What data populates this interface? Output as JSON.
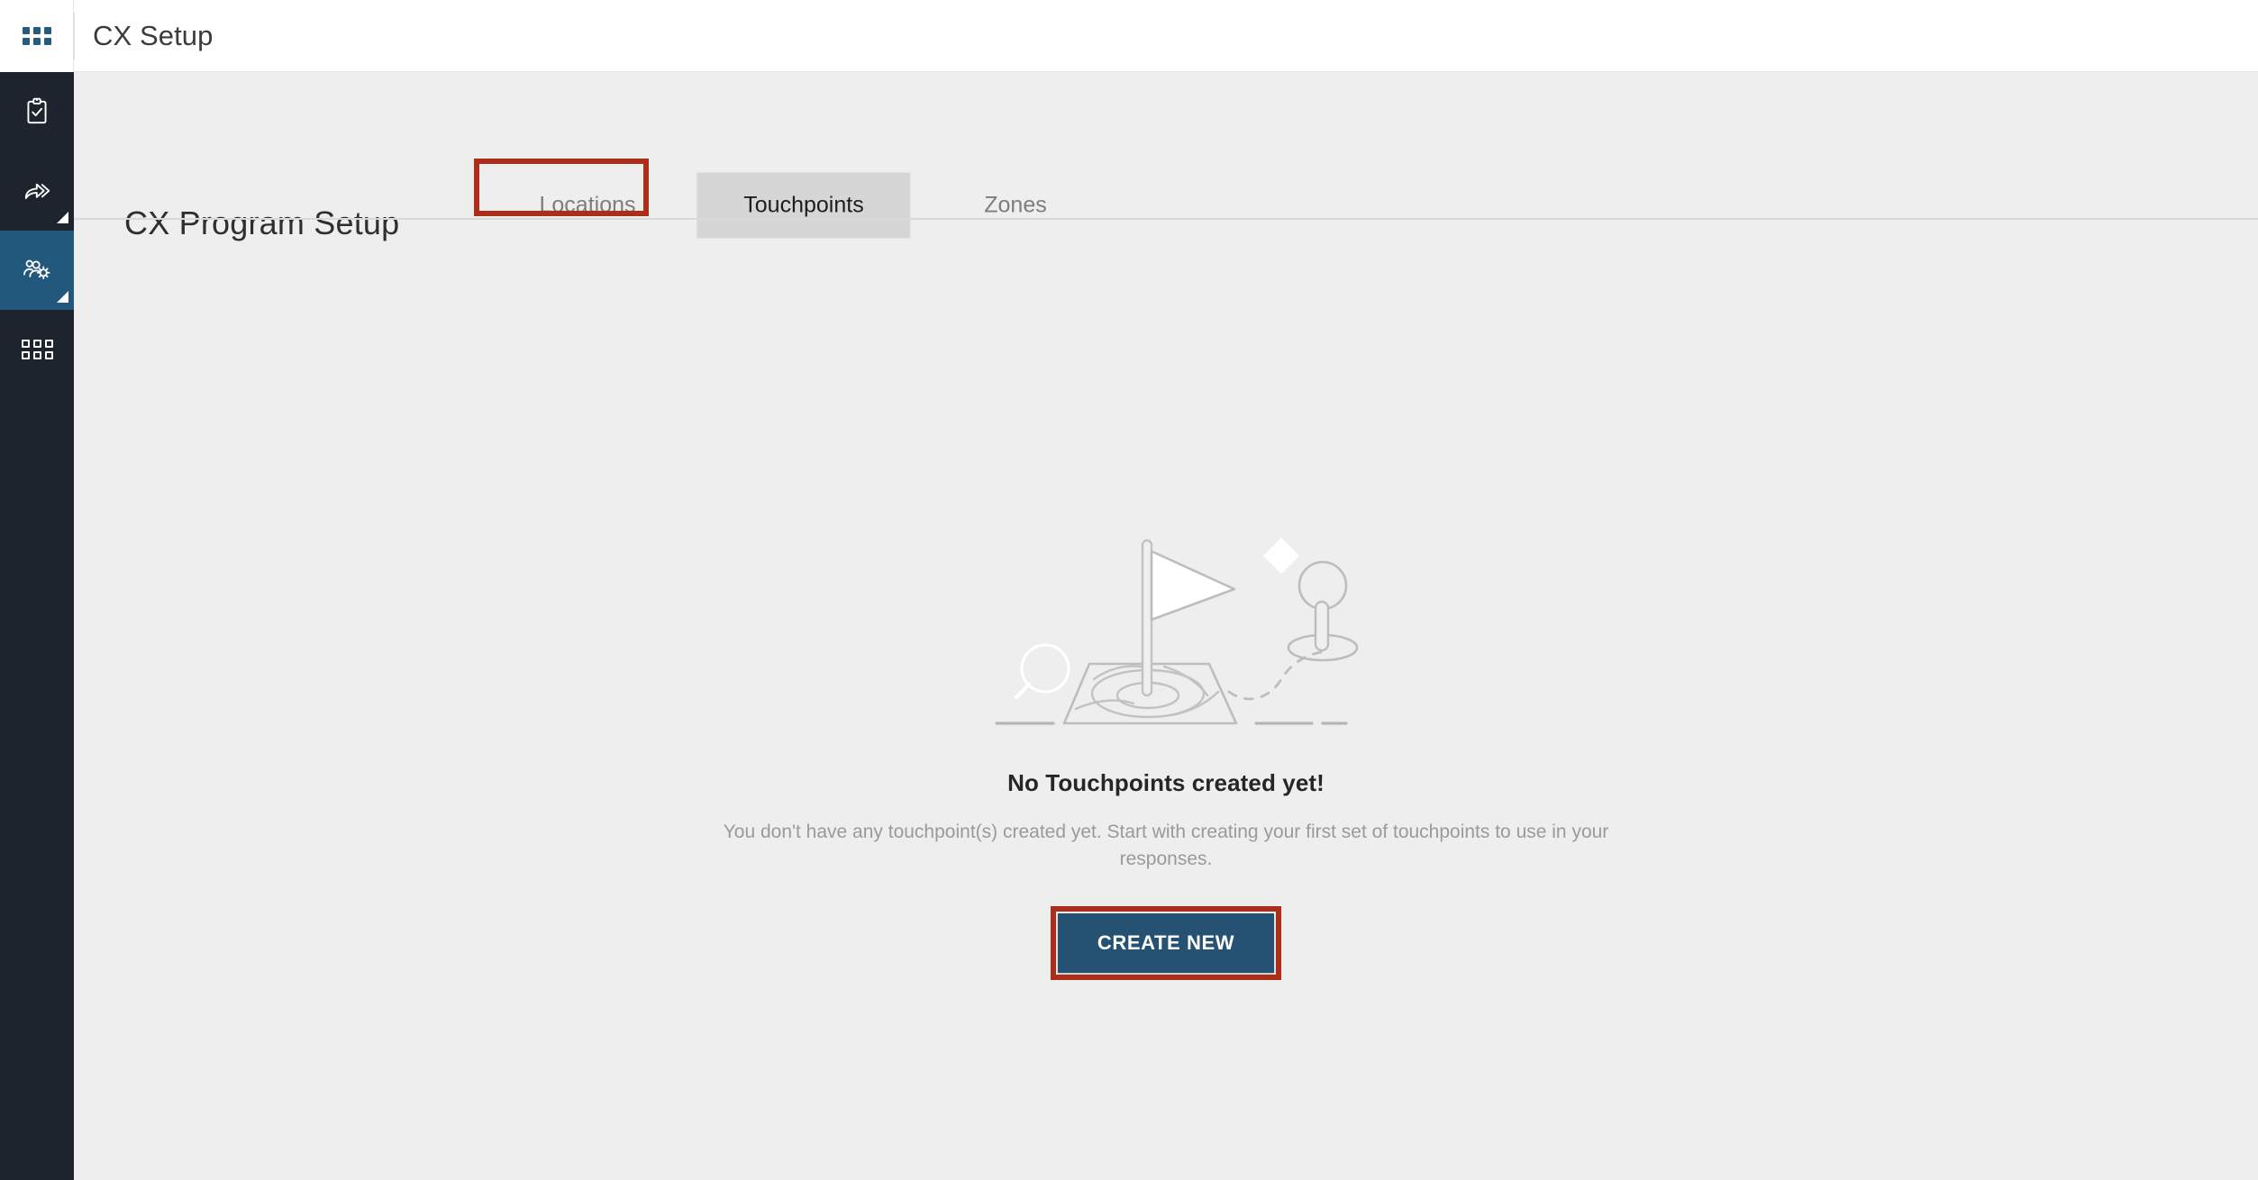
{
  "app": {
    "title": "CX Setup",
    "launcher_icon": "grid-apps-icon"
  },
  "sidebar": {
    "items": [
      {
        "icon": "clipboard-check-icon",
        "name": "surveys",
        "active": false,
        "has_submenu": false
      },
      {
        "icon": "share-forward-icon",
        "name": "distribute",
        "active": false,
        "has_submenu": true
      },
      {
        "icon": "users-gear-icon",
        "name": "cx-setup",
        "active": true,
        "has_submenu": true
      },
      {
        "icon": "grid-squares-icon",
        "name": "modules",
        "active": false,
        "has_submenu": false
      }
    ]
  },
  "page": {
    "title": "CX Program Setup"
  },
  "tabs": [
    {
      "label": "Locations",
      "active": false
    },
    {
      "label": "Touchpoints",
      "active": true
    },
    {
      "label": "Zones",
      "active": false
    }
  ],
  "empty_state": {
    "illustration": "flag-on-map-with-pin-illustration",
    "title": "No Touchpoints created yet!",
    "description": "You don't have any touchpoint(s) created yet. Start with creating your first set of touchpoints to use in your responses.",
    "cta_label": "CREATE NEW"
  },
  "annotations": {
    "highlight_color": "#ab2e1a",
    "targets": [
      "tab-touchpoints",
      "create-new-button"
    ]
  },
  "colors": {
    "rail_background": "#1e242e",
    "rail_active": "#23587d",
    "content_background": "#eeeeee",
    "header_background": "#ffffff",
    "primary_button": "#255272",
    "active_tab_background": "#d6d6d6",
    "launcher_accent": "#255b7e"
  }
}
